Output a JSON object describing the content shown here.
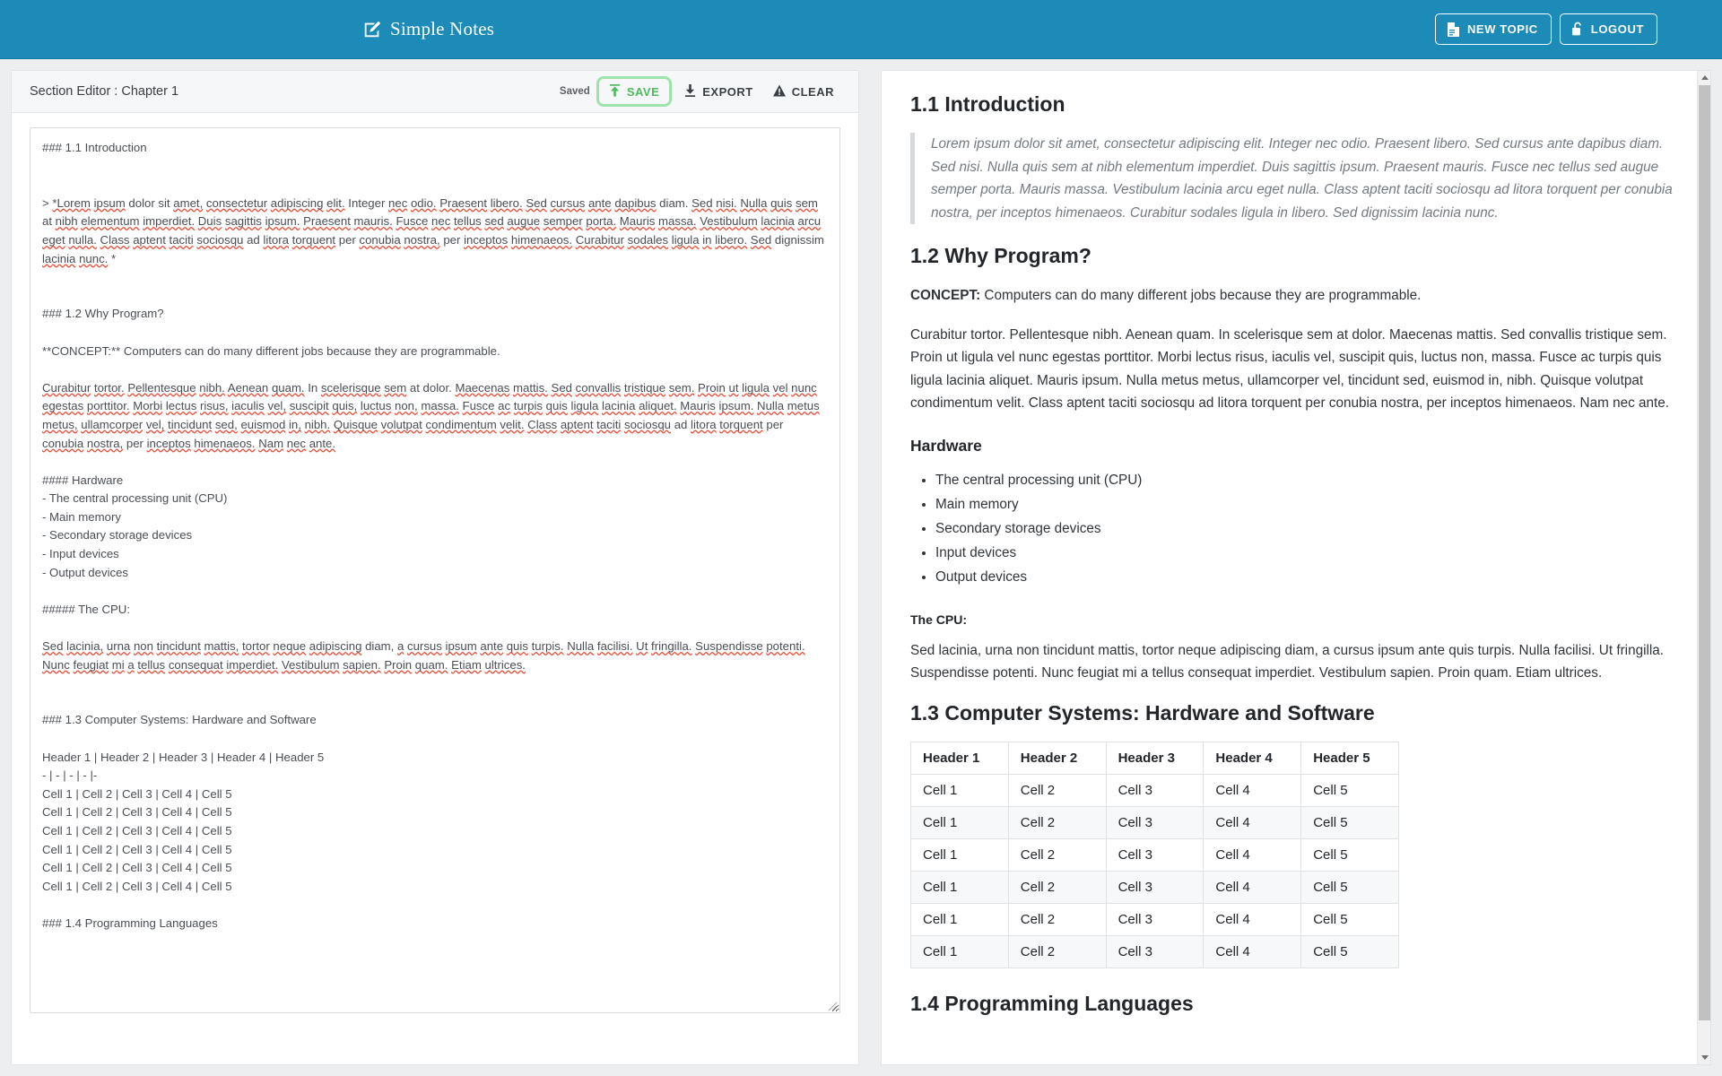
{
  "header": {
    "brand": "Simple Notes",
    "brand_icon": "edit-square-icon",
    "new_topic_label": "NEW TOPIC",
    "logout_label": "LOGOUT",
    "bg_color": "#1d8bb7"
  },
  "editor": {
    "title": "Section Editor : Chapter 1",
    "status": "Saved",
    "save_label": "SAVE",
    "export_label": "EXPORT",
    "clear_label": "CLEAR",
    "save_color": "#4cbb5f",
    "markdown_lines": [
      "### 1.1 Introduction",
      "",
      "",
      "> *Lorem ipsum dolor sit amet, consectetur adipiscing elit. Integer nec odio. Praesent libero. Sed cursus ante dapibus diam. Sed nisi. Nulla quis sem at nibh elementum imperdiet. Duis sagittis ipsum. Praesent mauris. Fusce nec tellus sed augue semper porta. Mauris massa. Vestibulum lacinia arcu eget nulla. Class aptent taciti sociosqu ad litora torquent per conubia nostra, per inceptos himenaeos. Curabitur sodales ligula in libero. Sed dignissim lacinia nunc. *",
      "",
      "",
      "### 1.2 Why Program?",
      "",
      "**CONCEPT:** Computers can do many different jobs because they are programmable.",
      "",
      "Curabitur tortor. Pellentesque nibh. Aenean quam. In scelerisque sem at dolor. Maecenas mattis. Sed convallis tristique sem. Proin ut ligula vel nunc egestas porttitor. Morbi lectus risus, iaculis vel, suscipit quis, luctus non, massa. Fusce ac turpis quis ligula lacinia aliquet. Mauris ipsum. Nulla metus metus, ullamcorper vel, tincidunt sed, euismod in, nibh. Quisque volutpat condimentum velit. Class aptent taciti sociosqu ad litora torquent per conubia nostra, per inceptos himenaeos. Nam nec ante.",
      "",
      "#### Hardware",
      "- The central processing unit (CPU)",
      "- Main memory",
      "- Secondary storage devices",
      "- Input devices",
      "- Output devices",
      "",
      "##### The CPU:",
      "",
      "Sed lacinia, urna non tincidunt mattis, tortor neque adipiscing diam, a cursus ipsum ante quis turpis. Nulla facilisi. Ut fringilla. Suspendisse potenti. Nunc feugiat mi a tellus consequat imperdiet. Vestibulum sapien. Proin quam. Etiam ultrices.",
      "",
      "",
      "### 1.3 Computer Systems: Hardware and Software",
      "",
      "Header 1 | Header 2 | Header 3 | Header 4 | Header 5",
      "- | - | - | - |-",
      "Cell 1 | Cell 2 | Cell 3 | Cell 4 | Cell 5",
      "Cell 1 | Cell 2 | Cell 3 | Cell 4 | Cell 5",
      "Cell 1 | Cell 2 | Cell 3 | Cell 4 | Cell 5",
      "Cell 1 | Cell 2 | Cell 3 | Cell 4 | Cell 5",
      "Cell 1 | Cell 2 | Cell 3 | Cell 4 | Cell 5",
      "Cell 1 | Cell 2 | Cell 3 | Cell 4 | Cell 5",
      "",
      "### 1.4 Programming Languages"
    ]
  },
  "preview": {
    "h_intro": "1.1 Introduction",
    "quote": "Lorem ipsum dolor sit amet, consectetur adipiscing elit. Integer nec odio. Praesent libero. Sed cursus ante dapibus diam. Sed nisi. Nulla quis sem at nibh elementum imperdiet. Duis sagittis ipsum. Praesent mauris. Fusce nec tellus sed augue semper porta. Mauris massa. Vestibulum lacinia arcu eget nulla. Class aptent taciti sociosqu ad litora torquent per conubia nostra, per inceptos himenaeos. Curabitur sodales ligula in libero. Sed dignissim lacinia nunc.",
    "h_why": "1.2 Why Program?",
    "concept_label": "CONCEPT:",
    "concept_text": " Computers can do many different jobs because they are programmable.",
    "why_paragraph": "Curabitur tortor. Pellentesque nibh. Aenean quam. In scelerisque sem at dolor. Maecenas mattis. Sed convallis tristique sem. Proin ut ligula vel nunc egestas porttitor. Morbi lectus risus, iaculis vel, suscipit quis, luctus non, massa. Fusce ac turpis quis ligula lacinia aliquet. Mauris ipsum. Nulla metus metus, ullamcorper vel, tincidunt sed, euismod in, nibh. Quisque volutpat condimentum velit. Class aptent taciti sociosqu ad litora torquent per conubia nostra, per inceptos himenaeos. Nam nec ante.",
    "h_hardware": "Hardware",
    "hardware_items": [
      "The central processing unit (CPU)",
      "Main memory",
      "Secondary storage devices",
      "Input devices",
      "Output devices"
    ],
    "h_cpu": "The CPU:",
    "cpu_paragraph": "Sed lacinia, urna non tincidunt mattis, tortor neque adipiscing diam, a cursus ipsum ante quis turpis. Nulla facilisi. Ut fringilla. Suspendisse potenti. Nunc feugiat mi a tellus consequat imperdiet. Vestibulum sapien. Proin quam. Etiam ultrices.",
    "h_systems": "1.3 Computer Systems: Hardware and Software",
    "table": {
      "headers": [
        "Header 1",
        "Header 2",
        "Header 3",
        "Header 4",
        "Header 5"
      ],
      "rows": [
        [
          "Cell 1",
          "Cell 2",
          "Cell 3",
          "Cell 4",
          "Cell 5"
        ],
        [
          "Cell 1",
          "Cell 2",
          "Cell 3",
          "Cell 4",
          "Cell 5"
        ],
        [
          "Cell 1",
          "Cell 2",
          "Cell 3",
          "Cell 4",
          "Cell 5"
        ],
        [
          "Cell 1",
          "Cell 2",
          "Cell 3",
          "Cell 4",
          "Cell 5"
        ],
        [
          "Cell 1",
          "Cell 2",
          "Cell 3",
          "Cell 4",
          "Cell 5"
        ],
        [
          "Cell 1",
          "Cell 2",
          "Cell 3",
          "Cell 4",
          "Cell 5"
        ]
      ]
    },
    "h_languages": "1.4 Programming Languages"
  }
}
